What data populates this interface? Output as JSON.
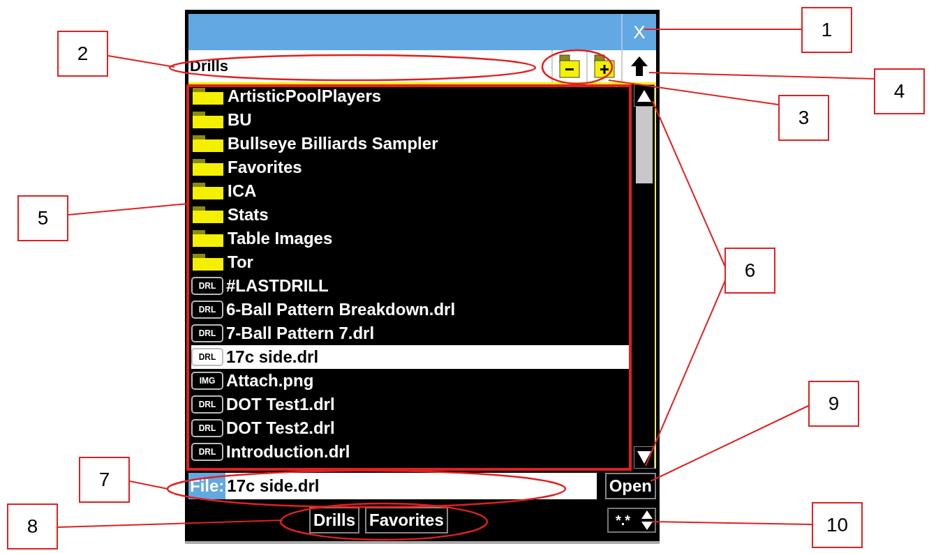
{
  "dialog": {
    "close_button": "X",
    "path": "Drills",
    "items": [
      {
        "kind": "folder",
        "name": "ArtisticPoolPlayers",
        "selected": false
      },
      {
        "kind": "folder",
        "name": "BU",
        "selected": false
      },
      {
        "kind": "folder",
        "name": "Bullseye Billiards Sampler",
        "selected": false
      },
      {
        "kind": "folder",
        "name": "Favorites",
        "selected": false
      },
      {
        "kind": "folder",
        "name": "ICA",
        "selected": false
      },
      {
        "kind": "folder",
        "name": "Stats",
        "selected": false
      },
      {
        "kind": "folder",
        "name": "Table Images",
        "selected": false
      },
      {
        "kind": "folder",
        "name": "Tor",
        "selected": false
      },
      {
        "kind": "file",
        "badge": "DRL",
        "name": "#LASTDRILL",
        "selected": false
      },
      {
        "kind": "file",
        "badge": "DRL",
        "name": "6-Ball Pattern Breakdown.drl",
        "selected": false
      },
      {
        "kind": "file",
        "badge": "DRL",
        "name": "7-Ball Pattern 7.drl",
        "selected": false
      },
      {
        "kind": "file",
        "badge": "DRL",
        "name": "17c side.drl",
        "selected": true
      },
      {
        "kind": "file",
        "badge": "IMG",
        "name": "Attach.png",
        "selected": false
      },
      {
        "kind": "file",
        "badge": "DRL",
        "name": "DOT Test1.drl",
        "selected": false
      },
      {
        "kind": "file",
        "badge": "DRL",
        "name": "DOT Test2.drl",
        "selected": false
      },
      {
        "kind": "file",
        "badge": "DRL",
        "name": "Introduction.drl",
        "selected": false
      }
    ],
    "file_label": "File:",
    "file_value": "17c side.drl",
    "open_button": "Open",
    "locations": [
      "Drills",
      "Favorites"
    ],
    "filter": "*.*"
  },
  "callouts": [
    "1",
    "2",
    "3",
    "4",
    "5",
    "6",
    "7",
    "8",
    "9",
    "10"
  ]
}
